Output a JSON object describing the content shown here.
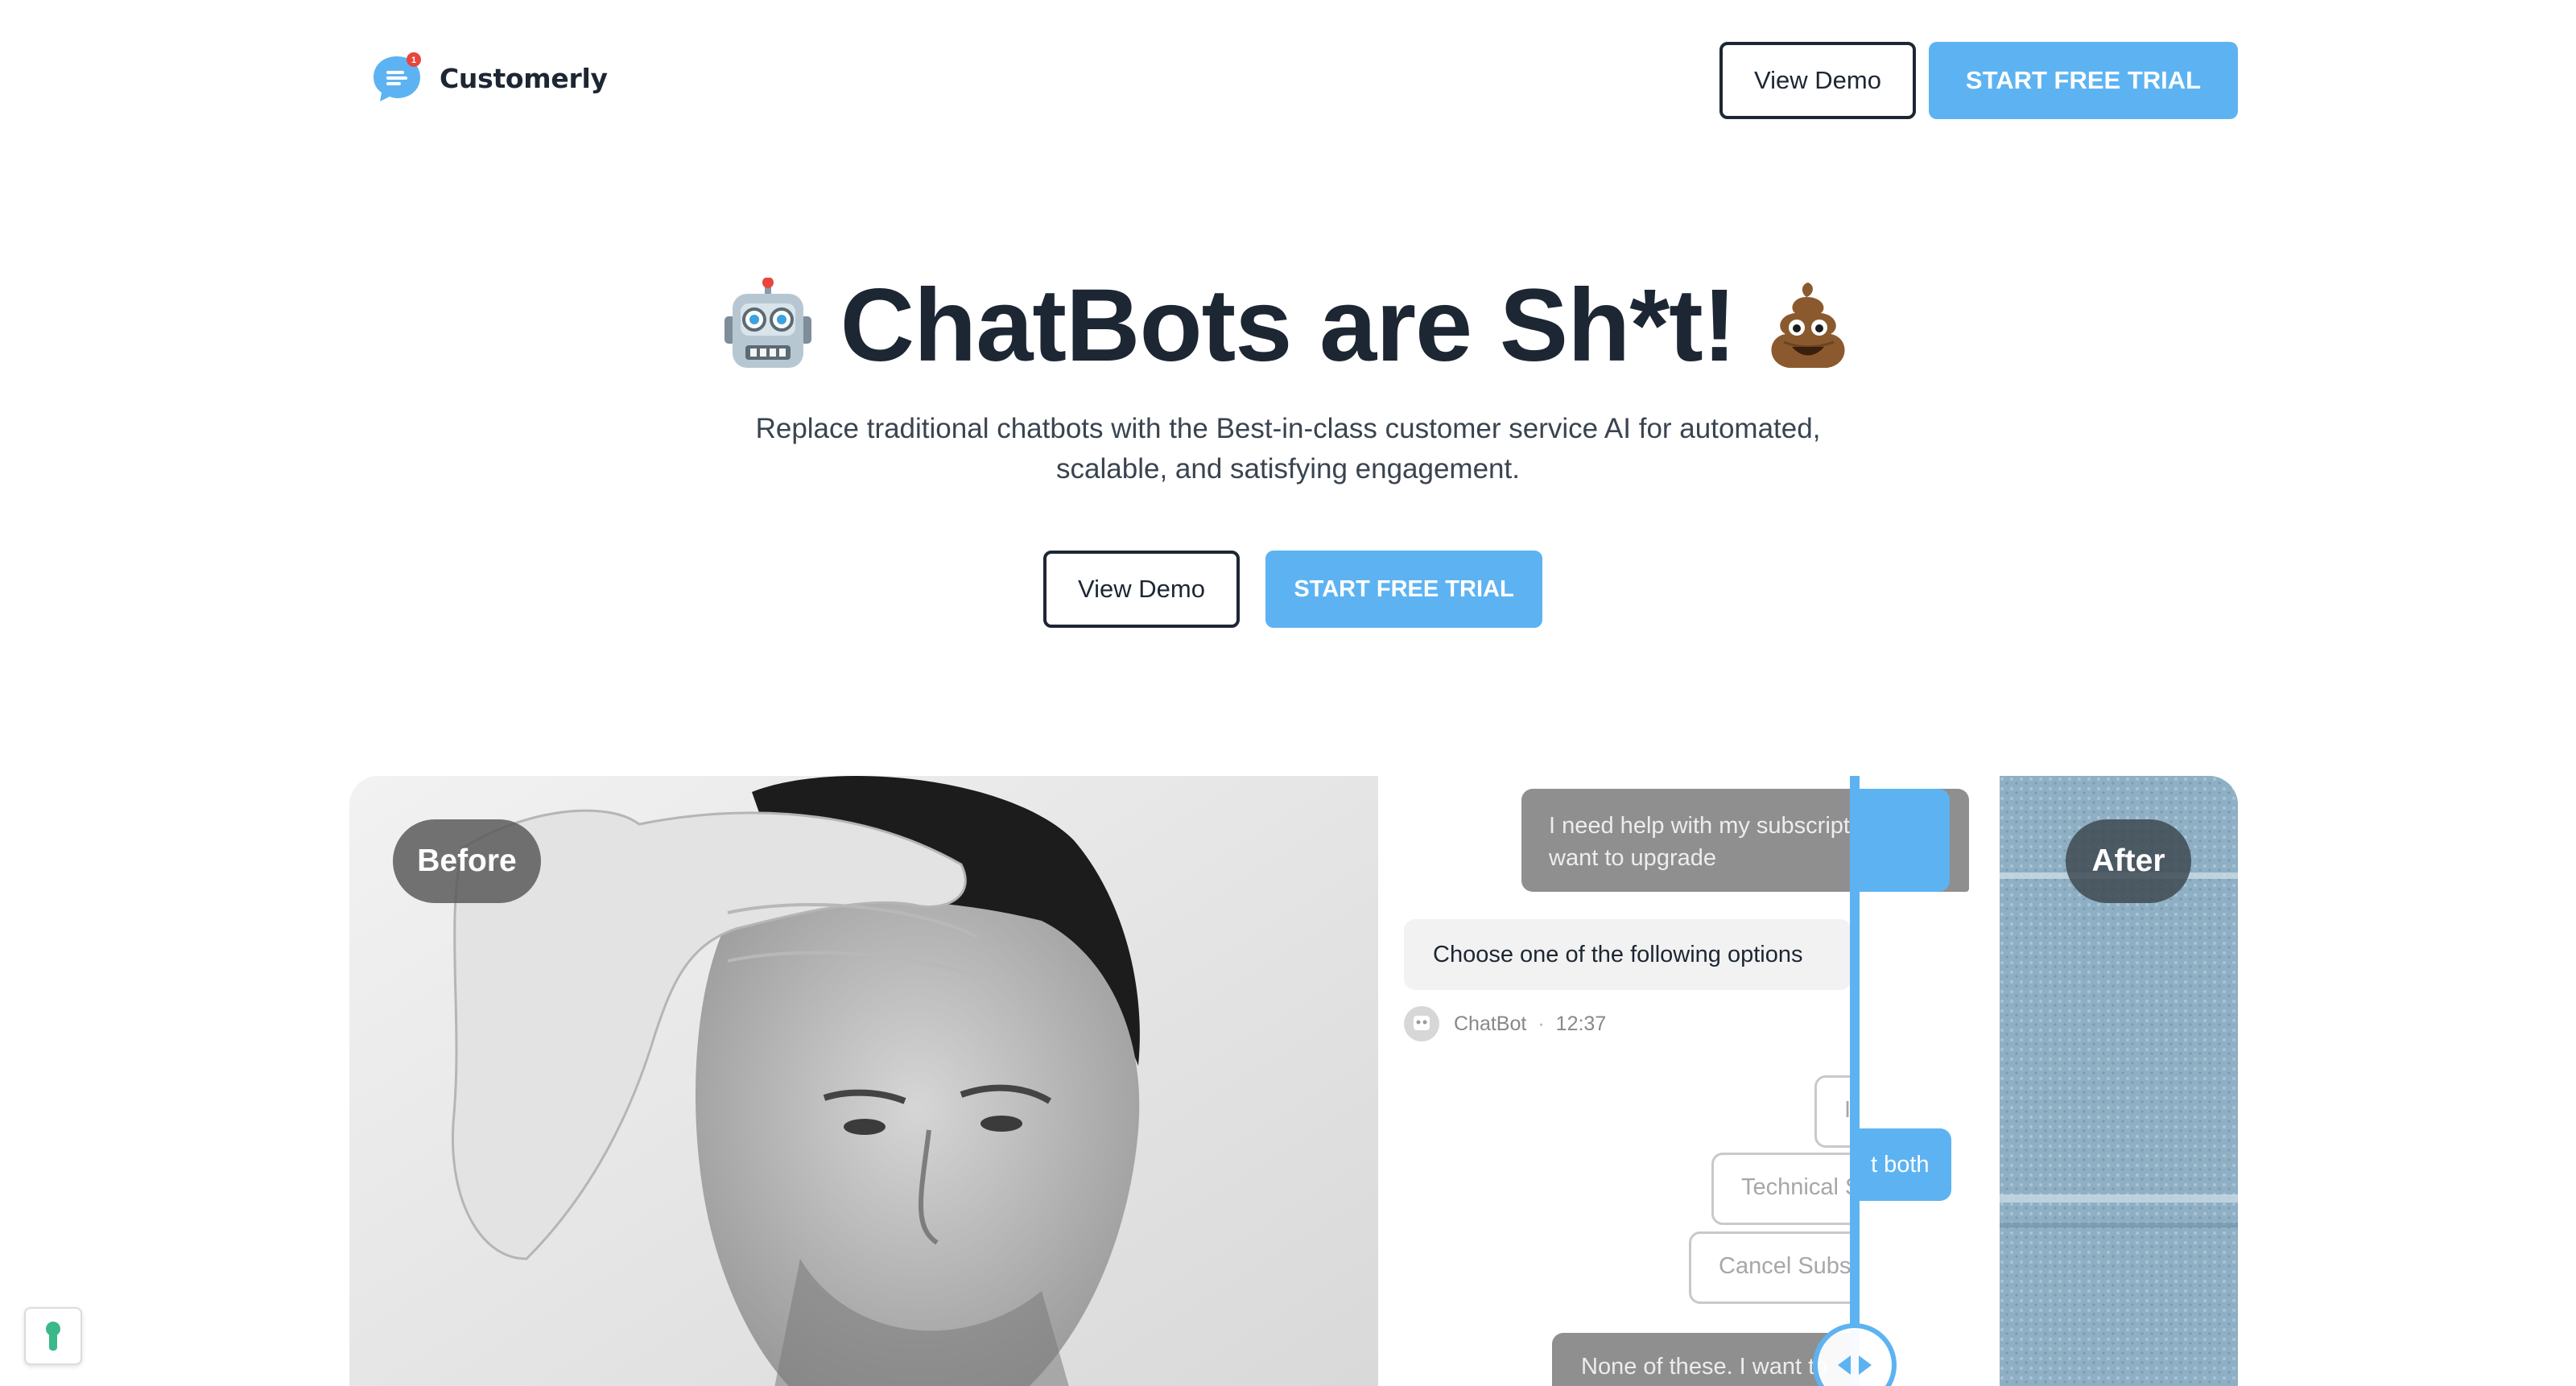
{
  "header": {
    "brand_name": "Customerly",
    "notification_count": "1",
    "view_demo_label": "View Demo",
    "start_trial_label": "START FREE TRIAL"
  },
  "hero": {
    "title": "ChatBots are Sh*t!",
    "title_emoji_left": "robot-face",
    "title_emoji_right": "pile-of-poo",
    "subtitle": "Replace traditional chatbots with the Best-in-class customer service AI for automated, scalable, and satisfying engagement.",
    "view_demo_label": "View Demo",
    "start_trial_label": "START FREE TRIAL"
  },
  "comparison": {
    "before_label": "Before",
    "after_label": "After",
    "chat": {
      "user_message": "I need help with my subscription. I want to upgrade",
      "bot_message": "Choose one of the following options",
      "bot_name": "ChatBot",
      "bot_time": "12:37",
      "options": [
        "In",
        "Technical S",
        "Cancel Subsc"
      ],
      "partial_blue_right": "t both",
      "user_message_2": "None of these. I want to"
    }
  },
  "colors": {
    "primary": "#5db3f2",
    "text_dark": "#1d2733",
    "bubble_grey": "#8f8f8f",
    "notification_red": "#e8453c"
  }
}
